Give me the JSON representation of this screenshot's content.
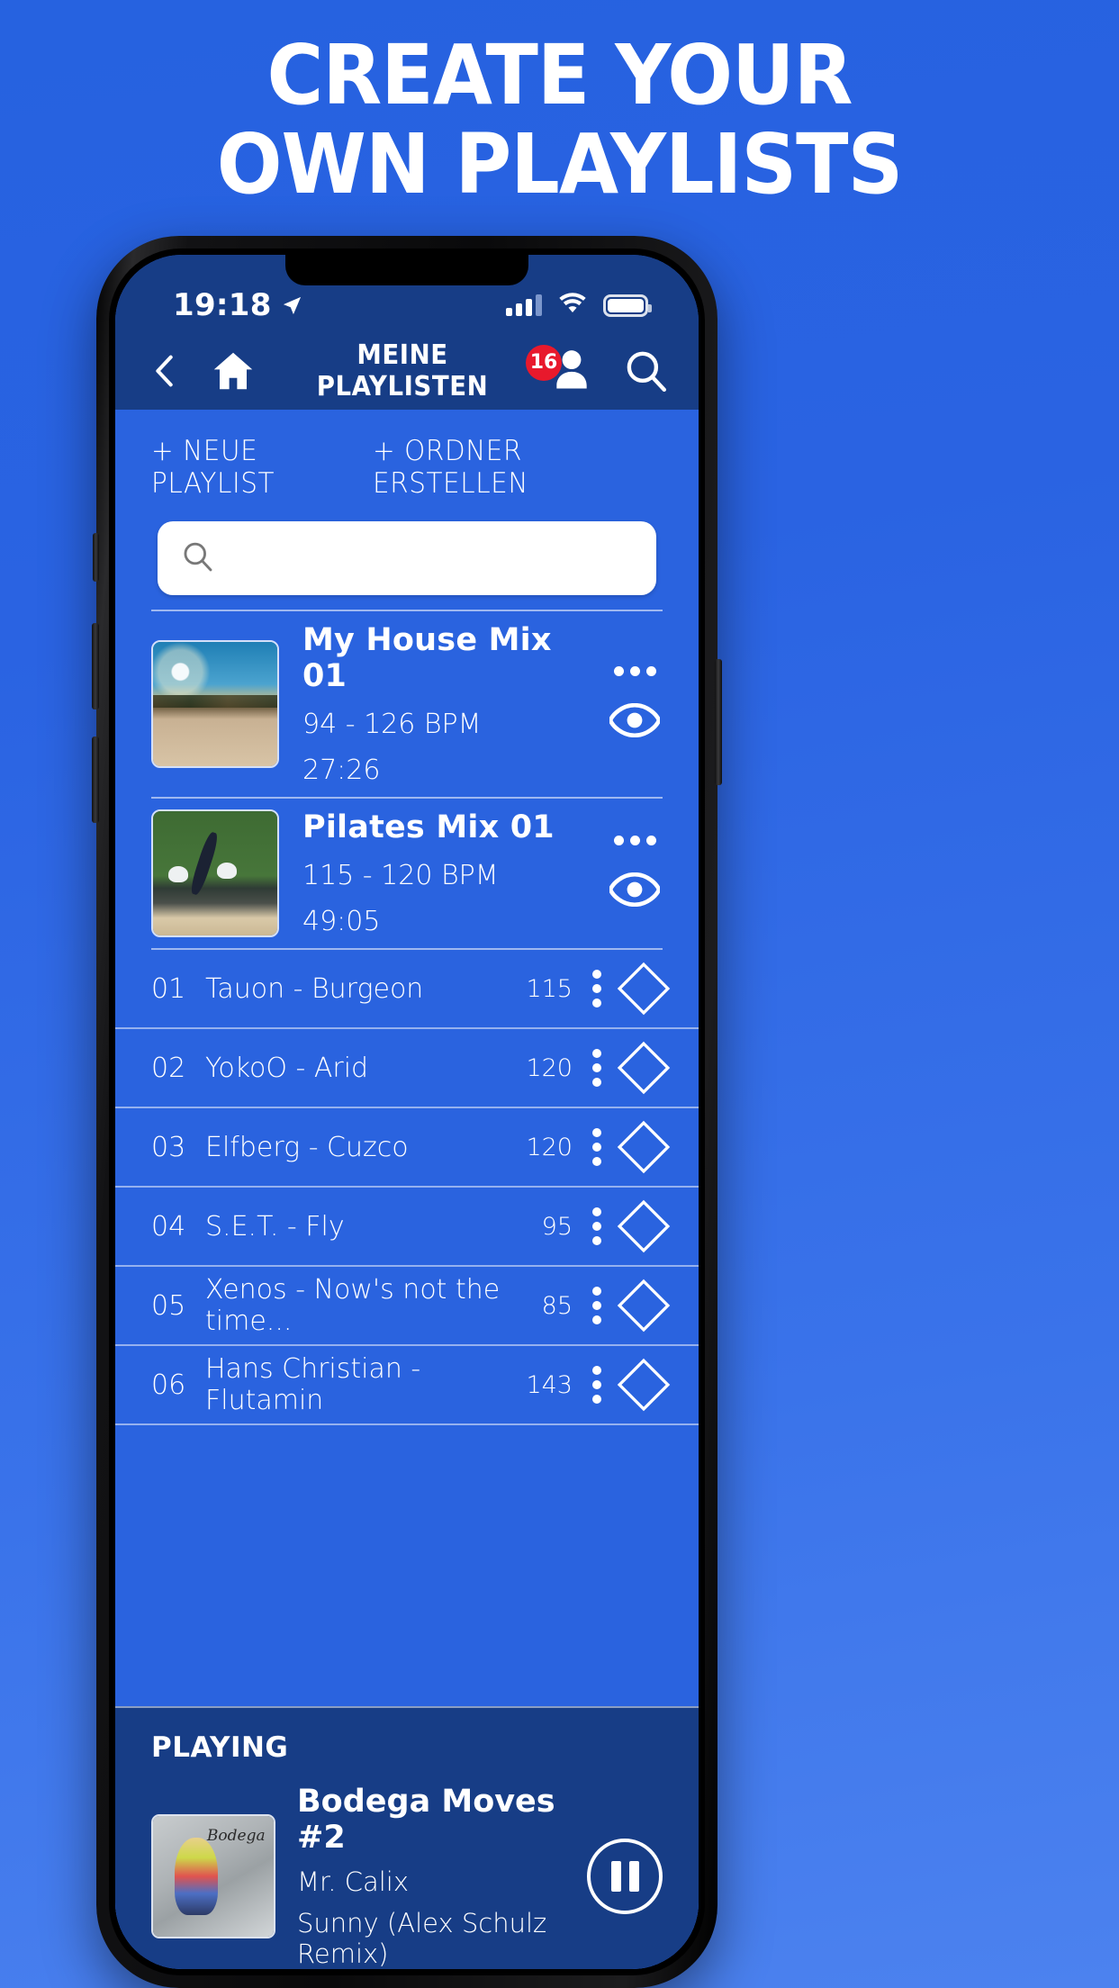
{
  "promo": {
    "line1": "CREATE YOUR",
    "line2": "OWN PLAYLISTS"
  },
  "status_bar": {
    "time": "19:18",
    "location_icon": "location-arrow-icon",
    "signal_icon": "cellular-signal-icon",
    "wifi_icon": "wifi-icon",
    "battery_icon": "battery-full-icon"
  },
  "header": {
    "back_icon": "chevron-left-icon",
    "home_icon": "home-icon",
    "title": "MEINE PLAYLISTEN",
    "badge_count": "16",
    "profile_icon": "person-icon",
    "search_icon": "search-icon"
  },
  "actions": {
    "new_playlist": "+ NEUE PLAYLIST",
    "create_folder": "+ ORDNER ERSTELLEN"
  },
  "search": {
    "placeholder": "",
    "value": "",
    "icon": "search-icon"
  },
  "playlists": [
    {
      "title": "My House Mix 01",
      "bpm": "94 - 126 BPM",
      "duration": "27:26",
      "art": "landscape-sunset-photo",
      "menu_icon": "more-horizontal-icon",
      "eye_icon": "eye-icon"
    },
    {
      "title": "Pilates Mix 01",
      "bpm": "115 - 120 BPM",
      "duration": "49:05",
      "art": "pilates-pose-photo",
      "menu_icon": "more-horizontal-icon",
      "eye_icon": "eye-icon"
    }
  ],
  "tracks": [
    {
      "no": "01",
      "name": "Tauon - Burgeon",
      "bpm": "115"
    },
    {
      "no": "02",
      "name": "YokoO - Arid",
      "bpm": "120"
    },
    {
      "no": "03",
      "name": "Elfberg - Cuzco",
      "bpm": "120"
    },
    {
      "no": "04",
      "name": "S.E.T. - Fly",
      "bpm": "95"
    },
    {
      "no": "05",
      "name": "Xenos - Now's not the time...",
      "bpm": "85"
    },
    {
      "no": "06",
      "name": "Hans Christian - Flutamin",
      "bpm": "143"
    }
  ],
  "now_playing": {
    "label": "PLAYING",
    "title": "Bodega Moves #2",
    "artist": "Mr. Calix",
    "track": "Sunny (Alex Schulz Remix)",
    "art": "bodega-moves-cover",
    "pause_icon": "pause-icon"
  },
  "colors": {
    "promo_bg": "#2a63df",
    "header_bg": "#173d86",
    "body_bg": "#2a63df",
    "badge_red": "#e8192c",
    "text_white": "#ffffff"
  }
}
